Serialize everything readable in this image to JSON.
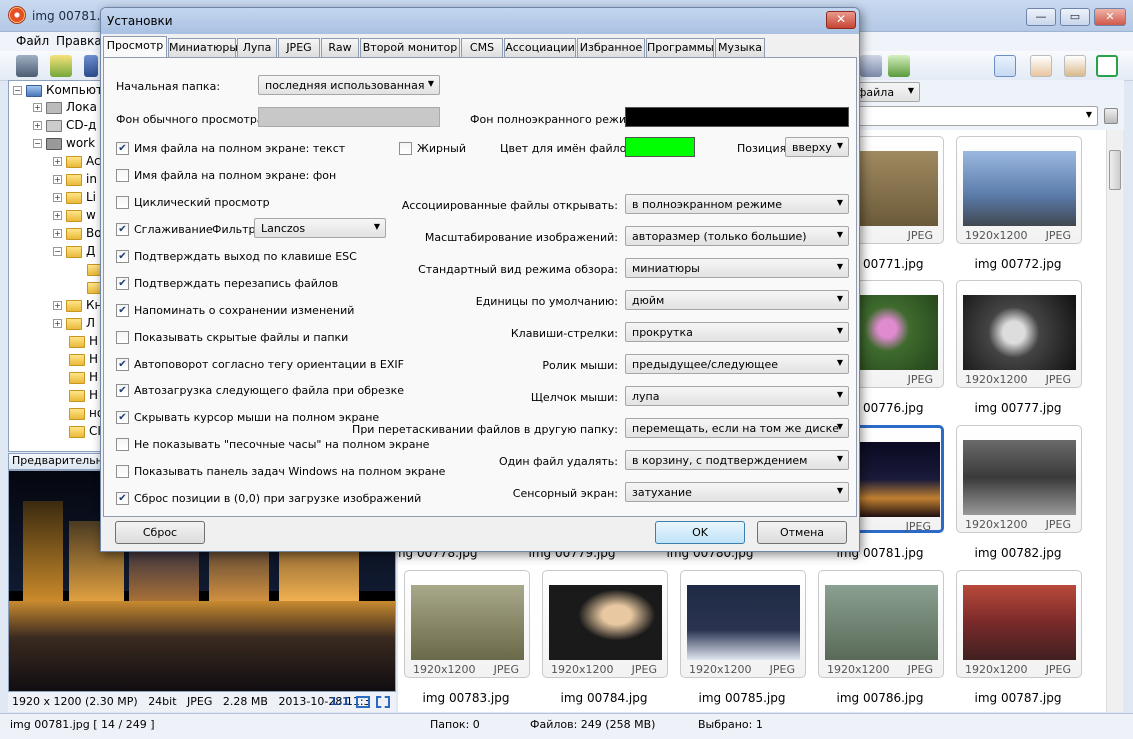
{
  "window": {
    "title": "img 00781.jpg",
    "minimize": "—",
    "maximize": "▭",
    "close": "✕"
  },
  "menu": [
    "Файл",
    "Правка"
  ],
  "tree": {
    "items": [
      "Компьют",
      "Лока",
      "CD-д",
      "work",
      "Ac",
      "in",
      "Li",
      "w",
      "Bo",
      "Д",
      "",
      "",
      "Кн",
      "Л",
      "Н",
      "Н",
      "Н",
      "Н",
      "но",
      "CI"
    ]
  },
  "preview": {
    "header": "Предварительны",
    "info": {
      "dims": "1920 x 1200 (2.30 MP)",
      "bit": "24bit",
      "fmt": "JPEG",
      "size": "2.28 MB",
      "date": "2013-10-28 11:3",
      "zoom": "1:1"
    }
  },
  "browser": {
    "sort_label": "файла"
  },
  "thumbs": [
    {
      "name": "img 00771.jpg",
      "dims": "1200",
      "fmt": "JPEG",
      "color": "#6b5a3a"
    },
    {
      "name": "img 00772.jpg",
      "dims": "1920x1200",
      "fmt": "JPEG",
      "color": "#5a7aa8"
    },
    {
      "name": "img 00776.jpg",
      "dims": "1200",
      "fmt": "JPEG",
      "color": "#3f6b2e"
    },
    {
      "name": "img 00777.jpg",
      "dims": "1920x1200",
      "fmt": "JPEG",
      "color": "#2b2b2b"
    },
    {
      "name": "img 00781.jpg",
      "dims": "1200",
      "fmt": "JPEG",
      "color": "#1a1a3a"
    },
    {
      "name": "img 00782.jpg",
      "dims": "1920x1200",
      "fmt": "JPEG",
      "color": "#4a4a4a"
    },
    {
      "name": "img 00778.jpg"
    },
    {
      "name": "img 00779.jpg"
    },
    {
      "name": "img 00780.jpg"
    },
    {
      "name": "img 00783.jpg",
      "dims": "1920x1200",
      "fmt": "JPEG",
      "color": "#8a8a6a"
    },
    {
      "name": "img 00784.jpg",
      "dims": "1920x1200",
      "fmt": "JPEG",
      "color": "#1a1a1a"
    },
    {
      "name": "img 00785.jpg",
      "dims": "1920x1200",
      "fmt": "JPEG",
      "color": "#1f2a44"
    },
    {
      "name": "img 00786.jpg",
      "dims": "1920x1200",
      "fmt": "JPEG",
      "color": "#6a7a60"
    },
    {
      "name": "img 00787.jpg",
      "dims": "1920x1200",
      "fmt": "JPEG",
      "color": "#7a2a2a"
    }
  ],
  "status": {
    "file": "img 00781.jpg [ 14 / 249 ]",
    "folders": "Папок: 0",
    "files": "Файлов: 249 (258 MB)",
    "selected": "Выбрано: 1"
  },
  "dialog": {
    "title": "Установки",
    "close": "✕",
    "tabs": [
      "Просмотр",
      "Миниатюры",
      "Лупа",
      "JPEG",
      "Raw",
      "Второй монитор",
      "CMS",
      "Ассоциации",
      "Избранное",
      "Программы",
      "Музыка"
    ],
    "start_folder_label": "Начальная папка:",
    "start_folder_value": "последняя использованная",
    "bg_normal_label": "Фон обычного просмотра:",
    "bg_full_label": "Фон полноэкранного режима:",
    "bold_label": "Жирный",
    "name_color_label": "Цвет для имён файлов:",
    "position_label": "Позиция:",
    "position_value": "вверху",
    "filter_label": "Фильтр:",
    "filter_value": "Lanczos",
    "checkboxes": [
      {
        "label": "Имя файла на полном экране: текст",
        "checked": "✔"
      },
      {
        "label": "Имя файла на полном экране: фон",
        "checked": ""
      },
      {
        "label": "Циклический просмотр",
        "checked": ""
      },
      {
        "label": "Сглаживание",
        "checked": "✔"
      },
      {
        "label": "Подтверждать выход по клавише ESC",
        "checked": "✔"
      },
      {
        "label": "Подтверждать перезапись файлов",
        "checked": "✔"
      },
      {
        "label": "Напоминать о сохранении изменений",
        "checked": "✔"
      },
      {
        "label": "Показывать скрытые файлы и папки",
        "checked": ""
      },
      {
        "label": "Автоповорот согласно тегу ориентации в EXIF",
        "checked": "✔"
      },
      {
        "label": "Автозагрузка следующего файла при обрезке",
        "checked": "✔"
      },
      {
        "label": "Скрывать курсор мыши на полном экране",
        "checked": "✔"
      },
      {
        "label": "Не показывать \"песочные часы\" на полном экране",
        "checked": ""
      },
      {
        "label": "Показывать панель задач Windows на полном экране",
        "checked": ""
      },
      {
        "label": "Сброс позиции в (0,0) при загрузке изображений",
        "checked": "✔"
      }
    ],
    "bold_checked": "",
    "options": [
      {
        "label": "Ассоциированные файлы открывать:",
        "value": "в полноэкранном режиме"
      },
      {
        "label": "Масштабирование изображений:",
        "value": "авторазмер (только большие)"
      },
      {
        "label": "Стандартный вид режима обзора:",
        "value": "миниатюры"
      },
      {
        "label": "Единицы по умолчанию:",
        "value": "дюйм"
      },
      {
        "label": "Клавиши-стрелки:",
        "value": "прокрутка"
      },
      {
        "label": "Ролик мыши:",
        "value": "предыдущее/следующее"
      },
      {
        "label": "Щелчок мыши:",
        "value": "лупа"
      },
      {
        "label": "При перетаскивании файлов в другую папку:",
        "value": "перемещать, если на том же диске"
      },
      {
        "label": "Один файл удалять:",
        "value": "в корзину, с подтверждением"
      },
      {
        "label": "Сенсорный экран:",
        "value": "затухание"
      }
    ],
    "reset_button": "Сброс",
    "ok_button": "OK",
    "cancel_button": "Отмена",
    "colors": {
      "bg_normal": "#c8c8c8",
      "bg_full": "#000000",
      "name_color": "#00ff00"
    }
  }
}
